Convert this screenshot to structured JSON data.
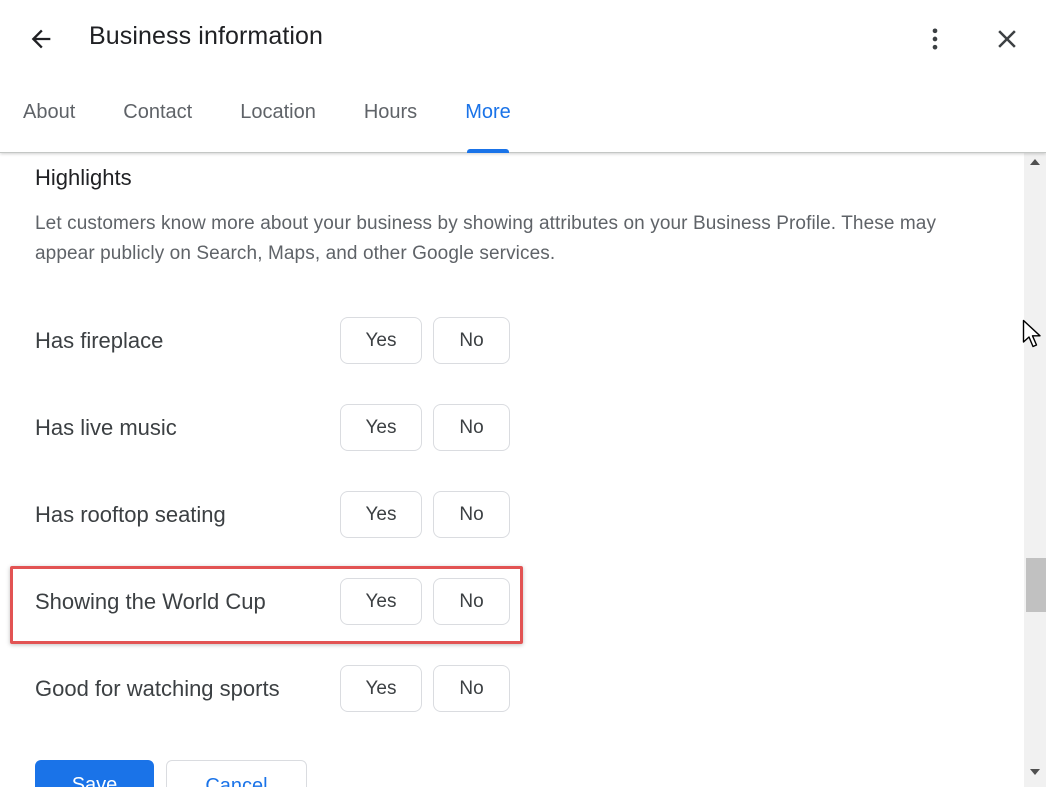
{
  "header": {
    "title": "Business information",
    "back_icon": "arrow-back-icon",
    "menu_icon": "more-vertical-icon",
    "close_icon": "close-icon"
  },
  "tabs": [
    {
      "label": "About",
      "active": false
    },
    {
      "label": "Contact",
      "active": false
    },
    {
      "label": "Location",
      "active": false
    },
    {
      "label": "Hours",
      "active": false
    },
    {
      "label": "More",
      "active": true
    }
  ],
  "section": {
    "title": "Highlights",
    "description": "Let customers know more about your business by showing attributes on your Business Profile. These may appear publicly on Search, Maps, and other Google services."
  },
  "attributes": [
    {
      "label": "Has fireplace",
      "yes": "Yes",
      "no": "No"
    },
    {
      "label": "Has live music",
      "yes": "Yes",
      "no": "No"
    },
    {
      "label": "Has rooftop seating",
      "yes": "Yes",
      "no": "No"
    },
    {
      "label": "Showing the World Cup",
      "yes": "Yes",
      "no": "No",
      "highlighted": true
    },
    {
      "label": "Good for watching sports",
      "yes": "Yes",
      "no": "No"
    }
  ],
  "actions": {
    "save_label": "Save",
    "cancel_label": "Cancel"
  },
  "colors": {
    "accent": "#1a73e8",
    "highlight_border": "#e25353",
    "text": "#3c4043",
    "muted_text": "#5f6368"
  }
}
